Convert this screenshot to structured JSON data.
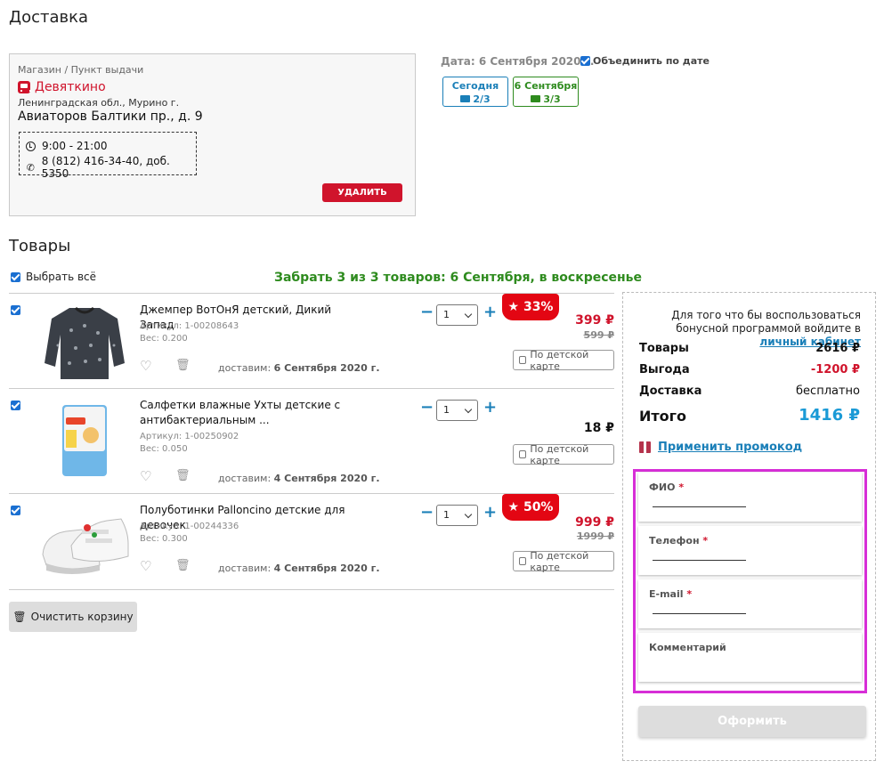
{
  "headings": {
    "delivery": "Доставка",
    "goods": "Товары"
  },
  "store": {
    "label": "Магазин / Пункт выдачи",
    "name": "Девяткино",
    "region": "Ленинградская обл., Мурино г.",
    "address": "Авиаторов Балтики пр., д. 9",
    "hours": "9:00 - 21:00",
    "phone": "8 (812) 416-34-40, доб. 5350",
    "delete_label": "УДАЛИТЬ"
  },
  "date": {
    "label": "Дата: 6 Сентября 2020 г.",
    "merge_label": "Объединить по дате",
    "merge_checked": true,
    "options": [
      {
        "title": "Сегодня",
        "count": "2/3",
        "color": "#1a7fb8"
      },
      {
        "title": "6 Сентября",
        "count": "3/3",
        "color": "#2e8b1e"
      }
    ]
  },
  "goods": {
    "select_all_label": "Выбрать всё",
    "pickup_text": "Забрать 3 из 3 товаров: 6 Сентября, в воскресенье",
    "card_label": "По детской карте",
    "delivery_prefix": "доставим:",
    "items": [
      {
        "title": "Джемпер ВотОнЯ детский, Дикий Запад",
        "sku": "Артикул: 1-00208643",
        "weight": "Вес: 0.200",
        "delivery_date": "6 Сентября 2020 г.",
        "qty": "1",
        "badge": "33%",
        "price": "399 ₽",
        "old_price": "599 ₽"
      },
      {
        "title": "Салфетки влажные Ухты детские с антибактериальным ...",
        "sku": "Артикул: 1-00250902",
        "weight": "Вес: 0.050",
        "delivery_date": "4 Сентября 2020 г.",
        "qty": "1",
        "badge": "",
        "price": "18 ₽",
        "old_price": ""
      },
      {
        "title": "Полуботинки Palloncino детские для девочек",
        "sku": "Артикул: 1-00244336",
        "weight": "Вес: 0.300",
        "delivery_date": "4 Сентября 2020 г.",
        "qty": "1",
        "badge": "50%",
        "price": "999 ₽",
        "old_price": "1999 ₽"
      }
    ],
    "clear_label": "Очистить корзину"
  },
  "summary": {
    "bonus_text": "Для того что бы воспользоваться бонусной программой войдите в",
    "bonus_link": "личный кабинет",
    "goods_label": "Товары",
    "goods_value": "2616 ₽",
    "benefit_label": "Выгода",
    "benefit_value": "-1200 ₽",
    "delivery_label": "Доставка",
    "delivery_value": "бесплатно",
    "total_label": "Итого",
    "total_value": "1416 ₽",
    "promo_label": "Применить промокод"
  },
  "form": {
    "name_label": "ФИО",
    "phone_label": "Телефон",
    "email_label": "E-mail",
    "comment_label": "Комментарий",
    "required_mark": "*",
    "submit_label": "Оформить"
  }
}
